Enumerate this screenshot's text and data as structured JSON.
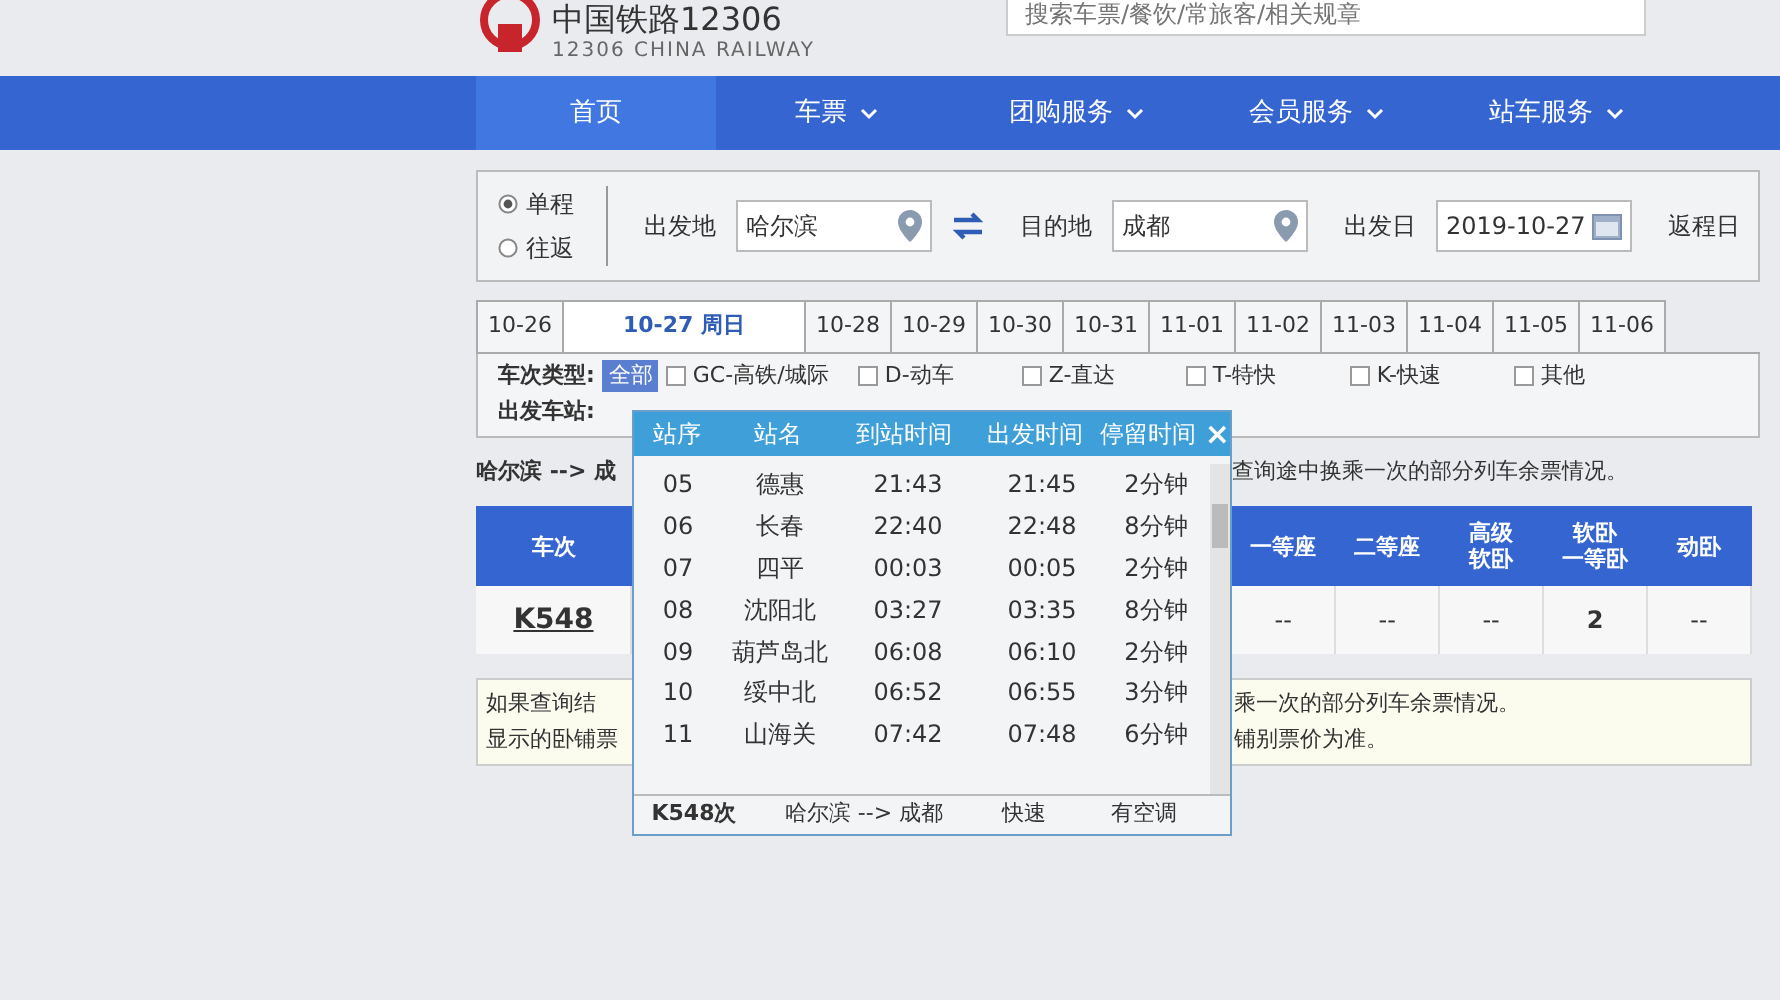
{
  "header": {
    "logo_title": "中国铁路12306",
    "logo_subtitle": "12306 CHINA RAILWAY",
    "search_placeholder": "搜索车票/餐饮/常旅客/相关规章"
  },
  "nav": [
    {
      "label": "首页",
      "dropdown": false,
      "selected": true
    },
    {
      "label": "车票",
      "dropdown": true,
      "selected": false
    },
    {
      "label": "团购服务",
      "dropdown": true,
      "selected": false
    },
    {
      "label": "会员服务",
      "dropdown": true,
      "selected": false
    },
    {
      "label": "站车服务",
      "dropdown": true,
      "selected": false
    }
  ],
  "search": {
    "trip_types": [
      {
        "label": "单程",
        "selected": true
      },
      {
        "label": "往返",
        "selected": false
      }
    ],
    "from": {
      "label": "出发地",
      "value": "哈尔滨"
    },
    "to": {
      "label": "目的地",
      "value": "成都"
    },
    "depart_date": {
      "label": "出发日",
      "value": "2019-10-27"
    },
    "return_date": {
      "label": "返程日"
    }
  },
  "date_tabs": [
    {
      "label": "10-26",
      "selected": false
    },
    {
      "label": "10-27 周日",
      "selected": true
    },
    {
      "label": "10-28",
      "selected": false
    },
    {
      "label": "10-29",
      "selected": false
    },
    {
      "label": "10-30",
      "selected": false
    },
    {
      "label": "10-31",
      "selected": false
    },
    {
      "label": "11-01",
      "selected": false
    },
    {
      "label": "11-02",
      "selected": false
    },
    {
      "label": "11-03",
      "selected": false
    },
    {
      "label": "11-04",
      "selected": false
    },
    {
      "label": "11-05",
      "selected": false
    },
    {
      "label": "11-06",
      "selected": false
    }
  ],
  "filters": {
    "train_type": {
      "label": "车次类型:",
      "all_label": "全部",
      "options": [
        {
          "label": "GC-高铁/城际",
          "checked": false
        },
        {
          "label": "D-动车",
          "checked": false
        },
        {
          "label": "Z-直达",
          "checked": false
        },
        {
          "label": "T-特快",
          "checked": false
        },
        {
          "label": "K-快速",
          "checked": false
        },
        {
          "label": "其他",
          "checked": false
        }
      ]
    },
    "station": {
      "label": "出发车站:"
    }
  },
  "route": {
    "left": "哈尔滨 --> 成",
    "right": "查询途中换乘一次的部分列车余票情况。"
  },
  "table": {
    "columns_left": [
      "车次"
    ],
    "columns_right": [
      {
        "lines": [
          "一等座"
        ]
      },
      {
        "lines": [
          "二等座"
        ]
      },
      {
        "lines": [
          "高级",
          "软卧"
        ]
      },
      {
        "lines": [
          "软卧",
          "一等卧"
        ]
      },
      {
        "lines": [
          "动卧"
        ]
      }
    ],
    "rows": [
      {
        "train": "K548",
        "cells": [
          "--",
          "--",
          "--",
          "2",
          "--"
        ]
      }
    ]
  },
  "notice": [
    {
      "left": "如果查询结",
      "right": "乘一次的部分列车余票情况。"
    },
    {
      "left": "显示的卧铺票",
      "right": "铺别票价为准。"
    }
  ],
  "popup": {
    "close": "×",
    "columns": [
      "站序",
      "站名",
      "到站时间",
      "出发时间",
      "停留时间"
    ],
    "rows": [
      {
        "seq": "05",
        "station": "德惠",
        "arrive": "21:43",
        "depart": "21:45",
        "stop": "2分钟"
      },
      {
        "seq": "06",
        "station": "长春",
        "arrive": "22:40",
        "depart": "22:48",
        "stop": "8分钟"
      },
      {
        "seq": "07",
        "station": "四平",
        "arrive": "00:03",
        "depart": "00:05",
        "stop": "2分钟"
      },
      {
        "seq": "08",
        "station": "沈阳北",
        "arrive": "03:27",
        "depart": "03:35",
        "stop": "8分钟"
      },
      {
        "seq": "09",
        "station": "葫芦岛北",
        "arrive": "06:08",
        "depart": "06:10",
        "stop": "2分钟"
      },
      {
        "seq": "10",
        "station": "绥中北",
        "arrive": "06:52",
        "depart": "06:55",
        "stop": "3分钟"
      },
      {
        "seq": "11",
        "station": "山海关",
        "arrive": "07:42",
        "depart": "07:48",
        "stop": "6分钟"
      }
    ],
    "footer": {
      "train": "K548次",
      "route": "哈尔滨 --> 成都",
      "train_type": "快速",
      "amenity": "有空调"
    }
  }
}
